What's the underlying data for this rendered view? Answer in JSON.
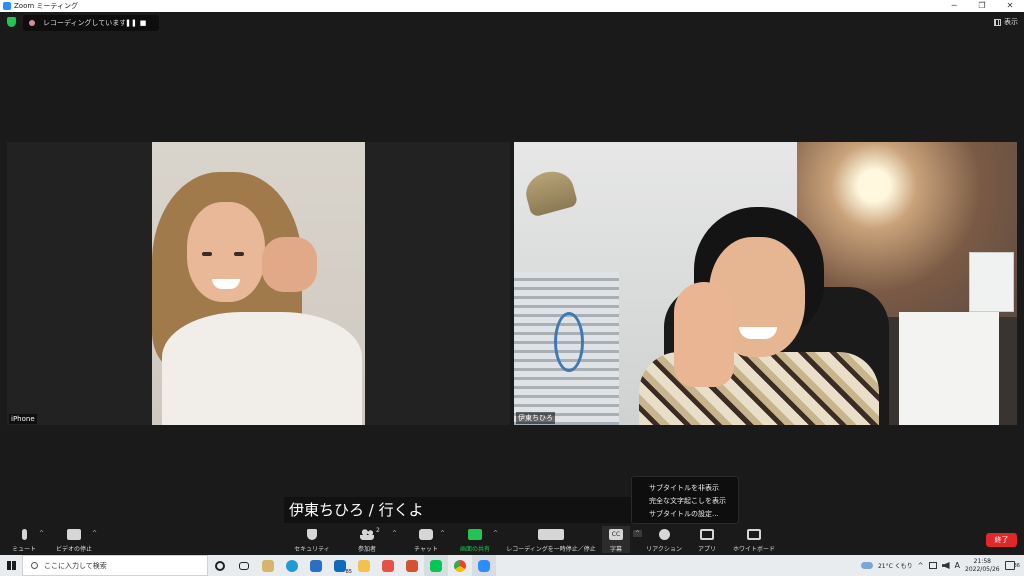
{
  "window": {
    "title": "Zoom ミーティング",
    "minimize": "─",
    "restore": "❐",
    "close": "✕"
  },
  "top": {
    "recording_text": "レコーディングしています...",
    "pause_glyph": "❚❚",
    "stop_glyph": "■",
    "view_label": "表示"
  },
  "participants": [
    {
      "name": "iPhone"
    },
    {
      "name": "伊東ちひろ"
    }
  ],
  "caption_text": "伊東ちひろ / 行くよ",
  "cc_menu": [
    "サブタイトルを非表示",
    "完全な文字起こしを表示",
    "サブタイトルの設定..."
  ],
  "toolbar": {
    "mute": "ミュート",
    "video": "ビデオの停止",
    "security": "セキュリティ",
    "participants": "参加者",
    "participants_count": "2",
    "chat": "チャット",
    "share": "画面の共有",
    "recording": "レコーディングを一時停止／停止",
    "cc": "字幕",
    "cc_icon_text": "CC",
    "reactions": "リアクション",
    "apps": "アプリ",
    "whiteboard": "ホワイトボード",
    "end": "終了",
    "caret": "^"
  },
  "taskbar": {
    "search_placeholder": "ここに入力して検索",
    "mail_badge": "85",
    "weather": "21°C くもり",
    "ime": "A",
    "time": "21:58",
    "date": "2022/05/26",
    "notif_badge": "36"
  },
  "colors": {
    "accent_green": "#23c552",
    "end_red": "#e02828",
    "zoom_blue": "#2d8cff"
  }
}
